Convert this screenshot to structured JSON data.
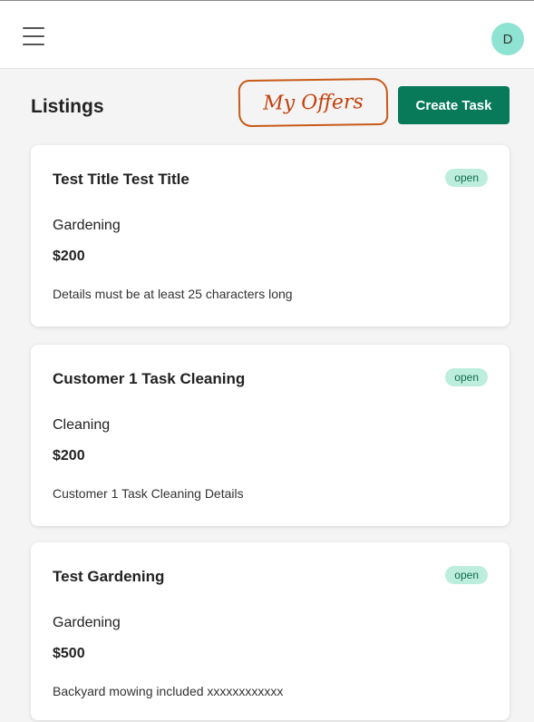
{
  "header": {
    "avatar_initial": "D"
  },
  "page": {
    "title": "Listings",
    "my_offers_label": "My Offers",
    "create_task_label": "Create Task"
  },
  "listings": [
    {
      "title": "Test Title Test Title",
      "status": "open",
      "category": "Gardening",
      "price": "$200",
      "details": "Details must be at least 25 characters long"
    },
    {
      "title": "Customer 1 Task Cleaning",
      "status": "open",
      "category": "Cleaning",
      "price": "$200",
      "details": "Customer 1 Task Cleaning Details"
    },
    {
      "title": "Test Gardening",
      "status": "open",
      "category": "Gardening",
      "price": "$500",
      "details": "Backyard mowing included xxxxxxxxxxxx"
    }
  ],
  "colors": {
    "accent": "#087a5a",
    "badge_bg": "#bdeedd",
    "avatar_bg": "#8ee3d2",
    "annotation": "#c2410c"
  }
}
